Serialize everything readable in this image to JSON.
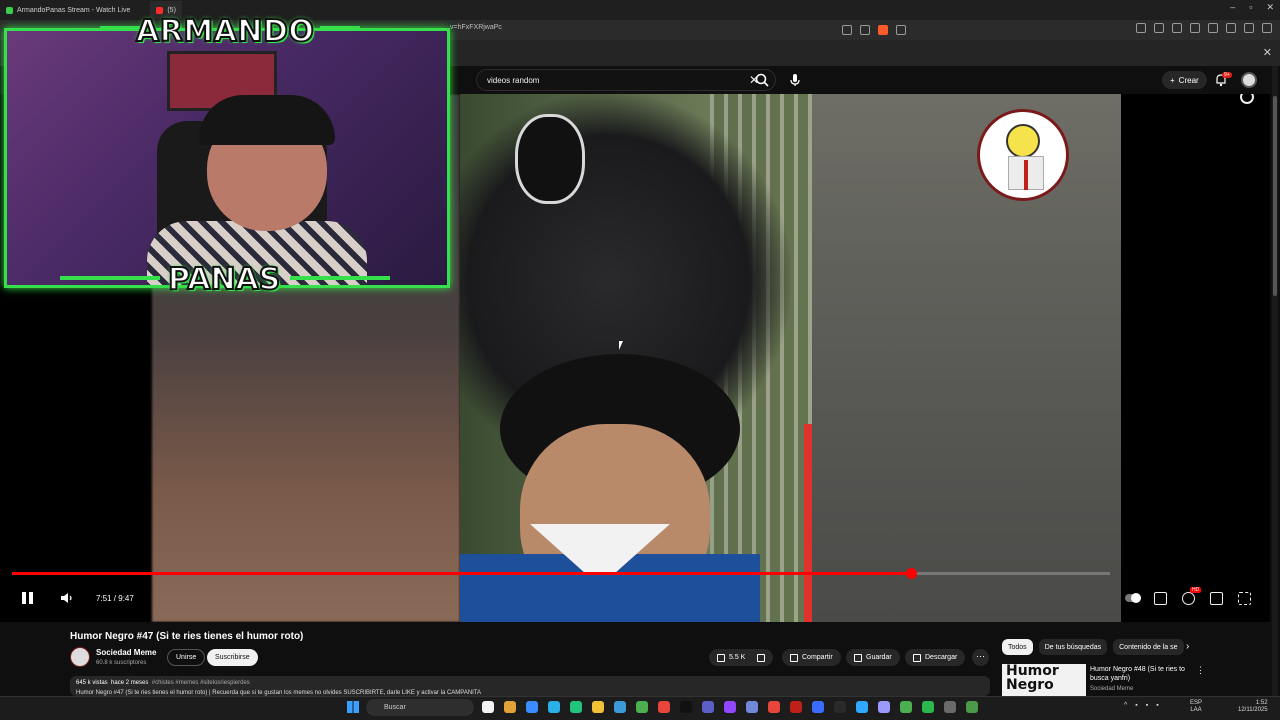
{
  "browser": {
    "tabs": [
      {
        "label": "ArmandoPanas Stream - Watch Live"
      },
      {
        "label": "(5)"
      }
    ],
    "url": "v=hFxFXRjwaPc"
  },
  "youtube": {
    "search": {
      "value": "videos random"
    },
    "create_label": "Crear",
    "notification_count": "9+"
  },
  "stream_overlay": {
    "title_top": "ARMANDO",
    "title_bottom": "PANAS"
  },
  "player": {
    "time_display": "7:51 / 9:47",
    "progress_fraction": 0.819,
    "quality_badge": "HD"
  },
  "video": {
    "title": "Humor Negro #47 (Si te ries tienes el humor roto)",
    "channel_name": "Sociedad Meme",
    "subscribers": "60.8 k suscriptores",
    "join_label": "Unirse",
    "subscribe_label": "Suscribirse",
    "likes": "5.5 K",
    "share_label": "Compartir",
    "save_label": "Guardar",
    "download_label": "Descargar",
    "views": "645 k vistas",
    "date": "hace 2 meses",
    "hashtags": "#chistes #memes #sitelosriespierdes",
    "description_line": "Humor Negro #47 (Si te ries tienes el humor roto) | Recuerda que si te gustan los memes no olvides SUSCRIBIRTE, darle LIKE y activar la CAMPANITA"
  },
  "sidebar": {
    "chips": [
      "Todos",
      "De tus búsquedas",
      "Contenido de la se"
    ],
    "recommendation": {
      "thumb_text": "Humor Negro",
      "title": "Humor Negro #48 (Si te ries to busca yanfri)",
      "channel": "Sociedad Meme"
    }
  },
  "taskbar": {
    "search_placeholder": "Buscar",
    "lang_top": "ESP",
    "lang_bottom": "LAA",
    "time": "1:52",
    "date": "12/11/2025",
    "app_colors": [
      "#f2f2f2",
      "#e2a23a",
      "#3a8cff",
      "#2ab0e6",
      "#22c47a",
      "#f2c037",
      "#3a9bd8",
      "#4caf50",
      "#e8453c",
      "#111111",
      "#5b5fc7",
      "#9146ff",
      "#7289da",
      "#e8453c",
      "#c0201a",
      "#3a6cff",
      "#2a2a2a",
      "#31a8ff",
      "#9999ff",
      "#4caf50",
      "#2ab84e",
      "#6a6a6a",
      "#4a9a4a"
    ]
  }
}
